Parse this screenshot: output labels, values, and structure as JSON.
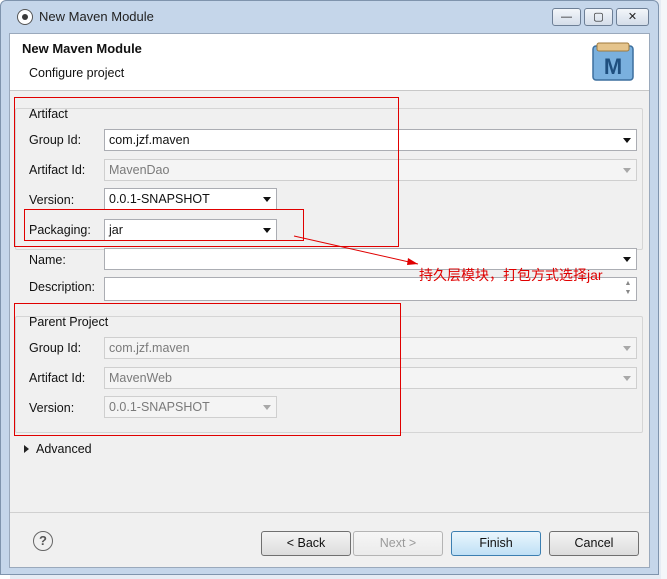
{
  "window": {
    "title": "New Maven Module"
  },
  "titlebar_buttons": {
    "minimize": "—",
    "maximize": "▢",
    "close": "✕"
  },
  "header": {
    "title": "New Maven Module",
    "subtitle": "Configure project",
    "logo_letter": "M"
  },
  "artifact": {
    "title": "Artifact",
    "group_id_label": "Group Id:",
    "group_id": "com.jzf.maven",
    "artifact_id_label": "Artifact Id:",
    "artifact_id": "MavenDao",
    "version_label": "Version:",
    "version": "0.0.1-SNAPSHOT",
    "packaging_label": "Packaging:",
    "packaging": "jar"
  },
  "name_label": "Name:",
  "name_value": "",
  "description_label": "Description:",
  "description_value": "",
  "annotation": "持久层模块，打包方式选择jar",
  "parent": {
    "title": "Parent Project",
    "group_id_label": "Group Id:",
    "group_id": "com.jzf.maven",
    "artifact_id_label": "Artifact Id:",
    "artifact_id": "MavenWeb",
    "version_label": "Version:",
    "version": "0.0.1-SNAPSHOT"
  },
  "advanced_label": "Advanced",
  "buttons": {
    "help": "?",
    "back": "< Back",
    "next": "Next >",
    "finish": "Finish",
    "cancel": "Cancel"
  },
  "colors": {
    "annotation_red": "#e00000",
    "window_frame": "#c5d6ea",
    "dialog_bg": "#f0f0f0"
  }
}
